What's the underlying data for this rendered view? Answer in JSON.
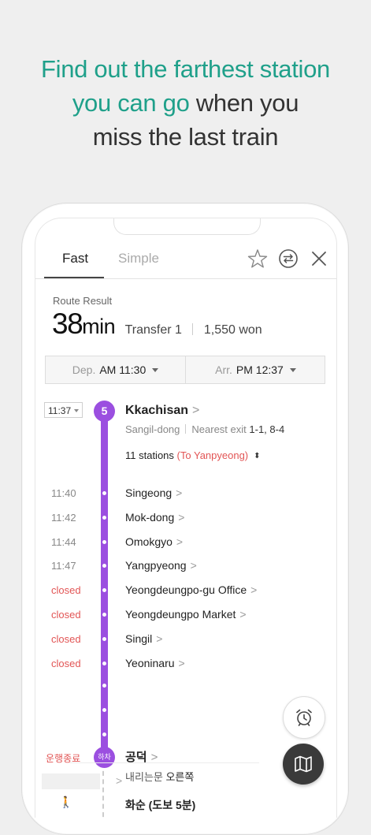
{
  "headline": {
    "line1": "Find out the farthest station",
    "line2_highlight": "you can go",
    "line2_rest": " when you",
    "line3": "miss the last train"
  },
  "tabs": {
    "fast": "Fast",
    "simple": "Simple"
  },
  "route": {
    "label": "Route Result",
    "time_value": "38",
    "time_unit": "min",
    "transfer": "Transfer 1",
    "fare": "1,550 won"
  },
  "departure": {
    "label": "Dep.",
    "value": "AM 11:30"
  },
  "arrival": {
    "label": "Arr.",
    "value": "PM 12:37"
  },
  "start": {
    "time": "11:37",
    "line_number": "5",
    "station": "Kkachisan",
    "area": "Sangil-dong",
    "exit_label": "Nearest exit",
    "exit_value": "1-1, 8-4",
    "stations_count": "11 stations",
    "direction": "(To Yanpyeong)"
  },
  "stops": [
    {
      "time": "11:40",
      "name": "Singeong",
      "closed": false
    },
    {
      "time": "11:42",
      "name": "Mok-dong",
      "closed": false
    },
    {
      "time": "11:44",
      "name": "Omokgyo",
      "closed": false
    },
    {
      "time": "11:47",
      "name": "Yangpyeong",
      "closed": false
    },
    {
      "time": "closed",
      "name": "Yeongdeungpo-gu Office",
      "closed": true
    },
    {
      "time": "closed",
      "name": "Yeongdeungpo Market",
      "closed": true
    },
    {
      "time": "closed",
      "name": "Singil",
      "closed": true
    },
    {
      "time": "closed",
      "name": "Yeoninaru",
      "closed": true
    }
  ],
  "end": {
    "status": "운행종료",
    "alight_badge": "하차",
    "station": "공덕",
    "door_label": "내리는문",
    "door_value": "오른쪽",
    "next_station": "화순 (도보 5분)"
  },
  "colors": {
    "accent_teal": "#1fa08a",
    "line5_purple": "#9b4fe0",
    "closed_red": "#e25555"
  }
}
